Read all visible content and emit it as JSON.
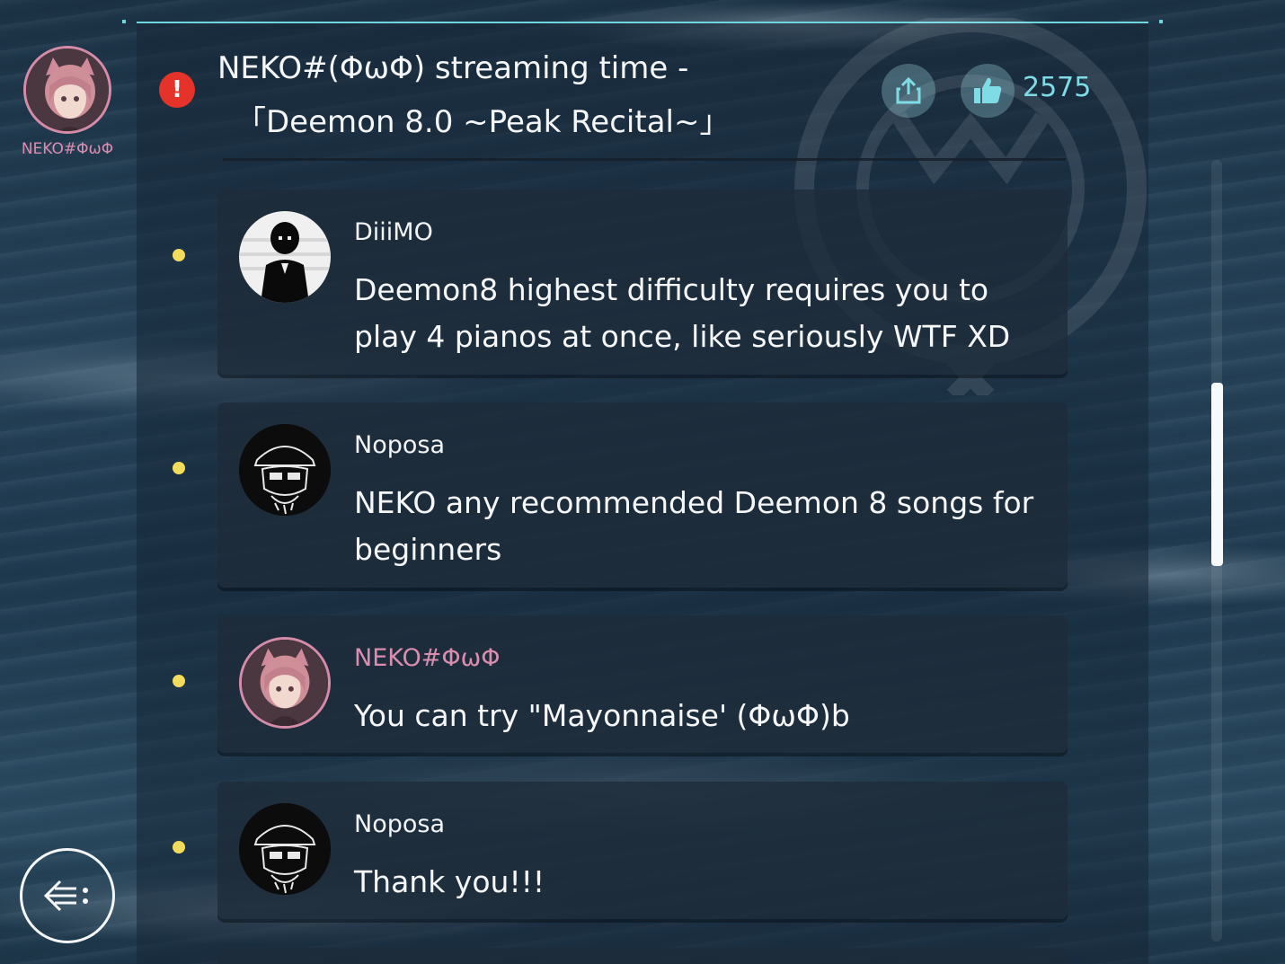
{
  "author": {
    "name": "NEKO#ΦωΦ"
  },
  "post": {
    "title_line1": "NEKO#(ΦωΦ) streaming time -",
    "title_line2": "「Deemon 8.0 ~Peak Recital~」",
    "like_count": "2575",
    "icons": {
      "alert": "alert-icon",
      "share": "share-icon",
      "like": "thumbs-up-icon",
      "back": "back-arrow-icon"
    }
  },
  "comments": [
    {
      "author": "DiiiMO",
      "text": "Deemon8 highest difficulty requires you to play 4 pianos at once, like seriously WTF XD"
    },
    {
      "author": "Noposa",
      "text": "NEKO any recommended Deemon 8 songs for beginners"
    },
    {
      "author": "NEKO#ΦωΦ",
      "text": "You can try \"Mayonnaise' (ΦωΦ)b"
    },
    {
      "author": "Noposa",
      "text": "Thank you!!!"
    }
  ],
  "colors": {
    "accent": "#7fdce6",
    "author_name": "#d98eb0",
    "bullet": "#f3dc5c",
    "alert": "#e5332a"
  }
}
